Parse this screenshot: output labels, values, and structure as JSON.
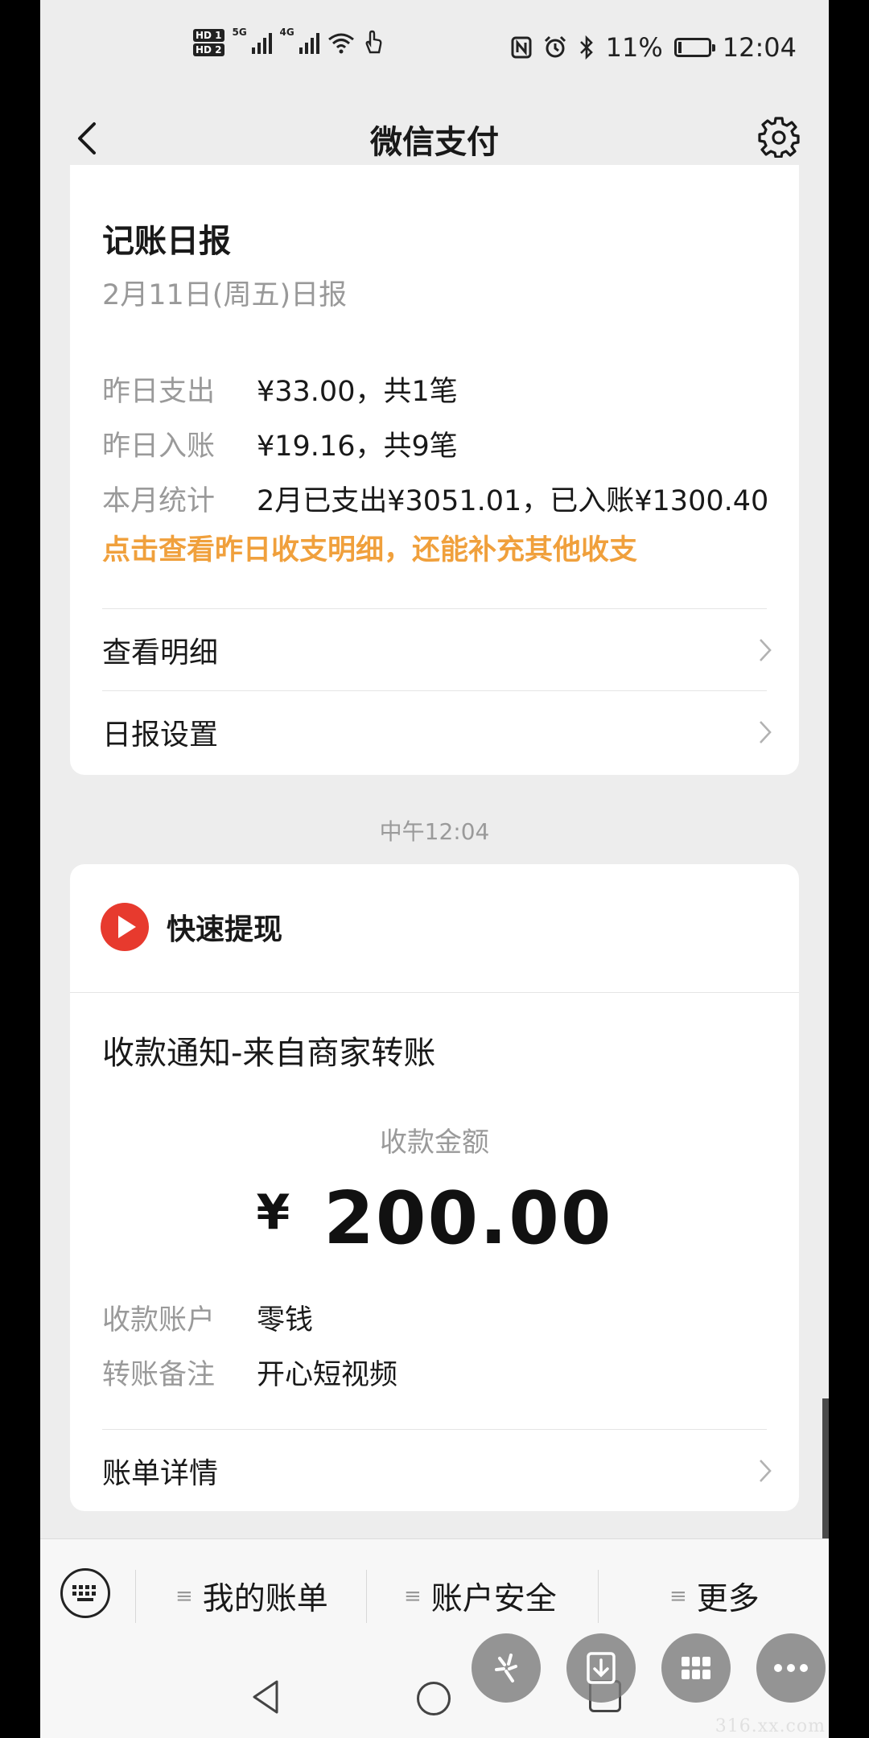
{
  "status_bar": {
    "hd1": "HD 1",
    "hd2": "HD 2",
    "net1": "5G",
    "net2": "4G",
    "battery_percent": "11%",
    "battery_level": 0.11,
    "time": "12:04"
  },
  "header": {
    "title": "微信支付",
    "back_icon": "chevron-left-icon",
    "settings_icon": "gear-icon"
  },
  "daily_report": {
    "title": "记账日报",
    "date": "2月11日(周五)日报",
    "rows": [
      {
        "label": "昨日支出",
        "value": "¥33.00，共1笔"
      },
      {
        "label": "昨日入账",
        "value": "¥19.16，共9笔"
      },
      {
        "label": "本月统计",
        "value": "2月已支出¥3051.01，已入账¥1300.40"
      }
    ],
    "hint": "点击查看昨日收支明细，还能补充其他收支",
    "links": [
      "查看明细",
      "日报设置"
    ]
  },
  "timestamp": "中午12:04",
  "payment": {
    "brand_name": "快速提现",
    "brand_logo_text": "开心短视频",
    "notice_title": "收款通知-来自商家转账",
    "amount_label": "收款金额",
    "currency": "¥",
    "amount": "200.00",
    "details": [
      {
        "label": "收款账户",
        "value": "零钱"
      },
      {
        "label": "转账备注",
        "value": "开心短视频"
      }
    ],
    "detail_link": "账单详情"
  },
  "menu_bar": {
    "keyboard_icon": "keyboard-icon",
    "items": [
      "我的账单",
      "账户安全",
      "更多"
    ]
  },
  "watermark": "316.xx.com",
  "colors": {
    "accent_orange": "#f0a03c",
    "background": "#ededed",
    "card": "#ffffff",
    "muted_text": "#9a9a9a"
  }
}
